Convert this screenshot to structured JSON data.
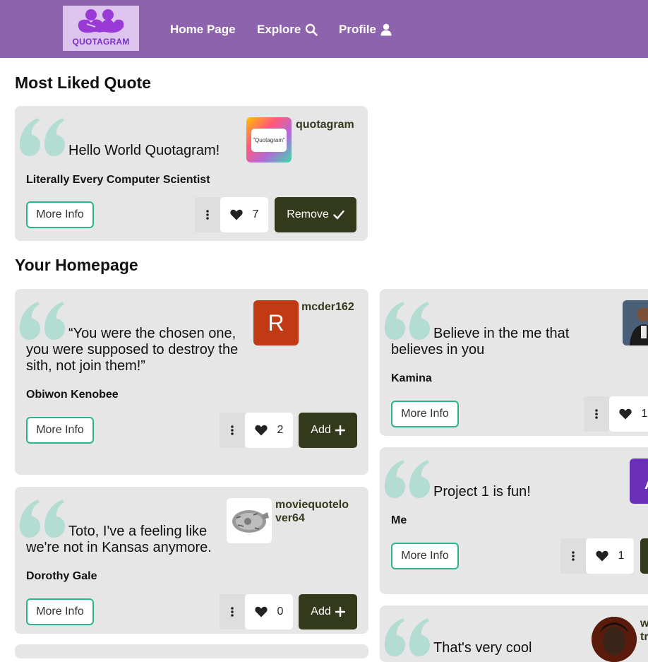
{
  "nav": {
    "logo_text": "QUOTAGRAM",
    "links": [
      {
        "label": "Home Page"
      },
      {
        "label": "Explore"
      },
      {
        "label": "Profile"
      }
    ]
  },
  "sections": {
    "most_liked": "Most Liked Quote",
    "homepage": "Your Homepage"
  },
  "featured": {
    "username": "quotagram",
    "avatar_text": "\"Quotagram\"",
    "quote": "Hello World Quotagram!",
    "author": "Literally Every Computer Scientist",
    "more_info": "More Info",
    "likes": "7",
    "action": "Remove"
  },
  "cards": [
    {
      "username": "mcder162",
      "avatar_letter": "R",
      "quote_lines": [
        "“You were the chosen one,",
        "you were supposed to destroy the",
        "sith, not join them!”"
      ],
      "author": "Obiwon Kenobee",
      "more_info": "More Info",
      "likes": "2",
      "action": "Add"
    },
    {
      "username_lines": [
        "moviequotelo",
        "ver64"
      ],
      "quote_lines": [
        "Toto, I've a feeling like",
        "we're not in Kansas anymore."
      ],
      "author": "Dorothy Gale",
      "more_info": "More Info",
      "likes": "0",
      "action": "Add"
    },
    {
      "quote_lines": [
        "Believe in the me that",
        "believes in you"
      ],
      "author": "Kamina",
      "more_info": "More Info",
      "likes": "1"
    },
    {
      "quote": "Project 1 is fun!",
      "author": "Me",
      "more_info": "More Info",
      "likes": "1",
      "avatar_letter": "A"
    },
    {
      "quote": "That's very cool",
      "username_lines": [
        "w",
        "tr"
      ]
    }
  ],
  "colors": {
    "nav": "#8e63ad",
    "accent": "#2db38f",
    "dark_button": "#333a1c",
    "card": "#e6e6e6",
    "quote_mark": "#b3ddd2"
  }
}
